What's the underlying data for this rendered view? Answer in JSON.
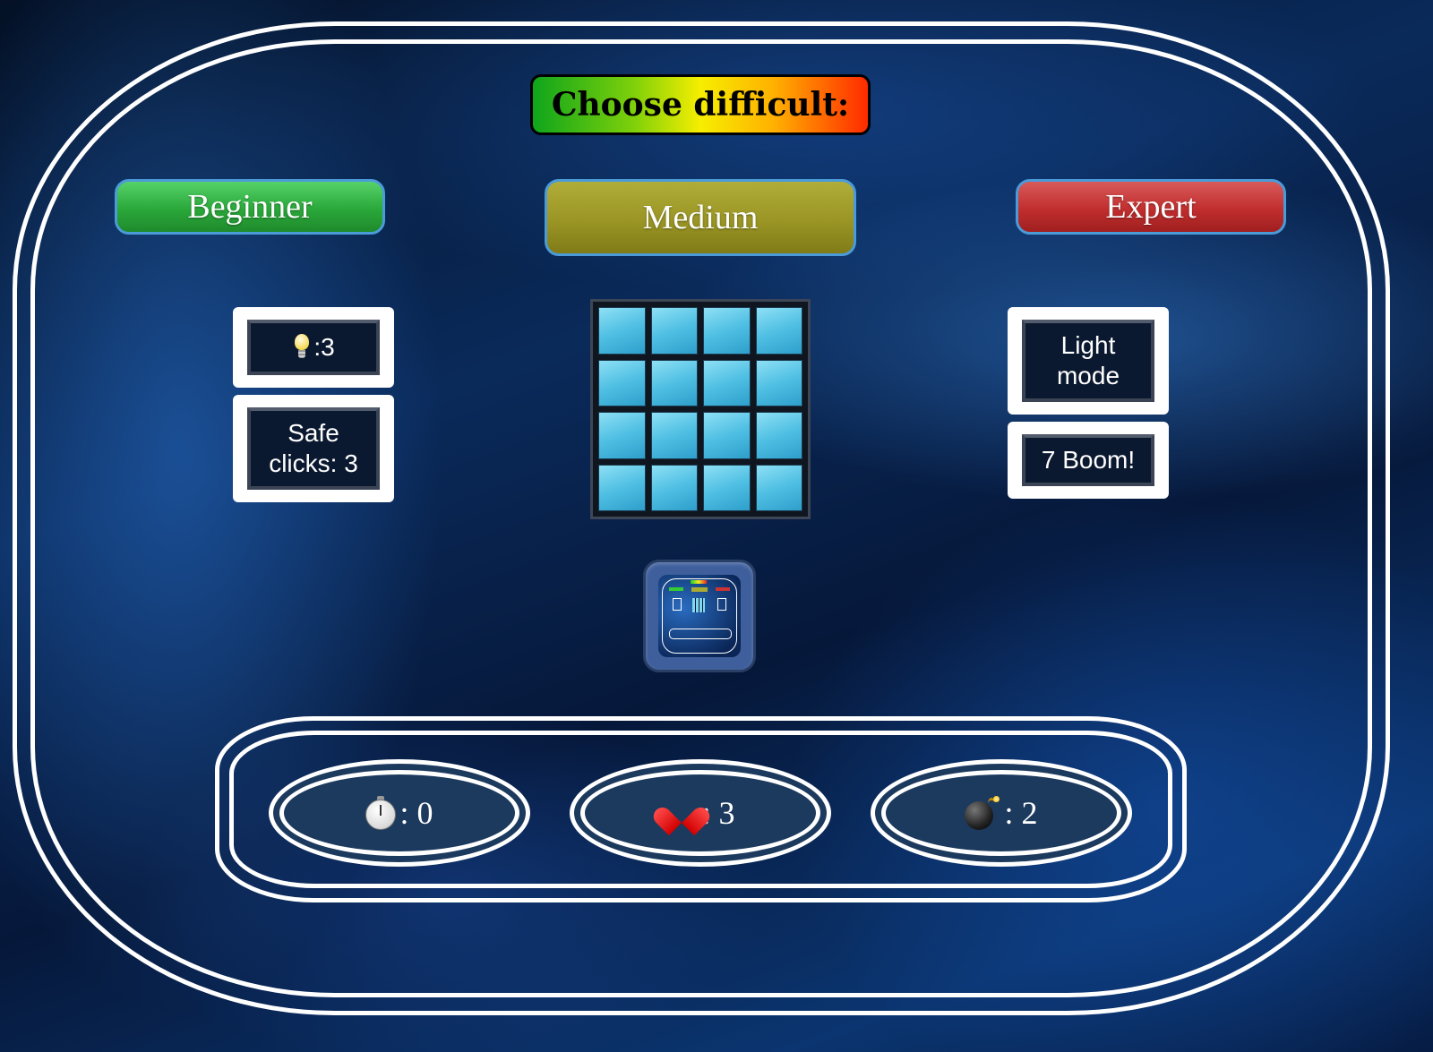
{
  "title": "Choose difficult:",
  "difficulty": {
    "beginner": "Beginner",
    "medium": "Medium",
    "expert": "Expert",
    "colors": {
      "beginner": "#2aa83a",
      "medium": "#9a9524",
      "expert": "#c12e2e"
    }
  },
  "left_panel": {
    "hints_icon": "light-bulb-icon",
    "hints_label": ":3",
    "safe_clicks_label": "Safe clicks: 3"
  },
  "right_panel": {
    "light_mode_label": "Light mode",
    "seven_boom_label": "7 Boom!"
  },
  "board": {
    "rows": 4,
    "cols": 4,
    "cell_color": "#4fbfe3"
  },
  "restart_button": {
    "icon": "game-thumbnail-icon"
  },
  "stats": {
    "timer_icon": "stopwatch-icon",
    "timer_label": ": 0",
    "lives_icon": "heart-icon",
    "lives_label": ": 3",
    "mines_icon": "bomb-icon",
    "mines_label": ": 2"
  }
}
